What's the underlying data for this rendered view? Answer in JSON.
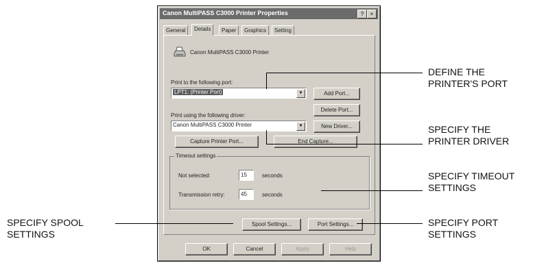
{
  "window": {
    "title": "Canon MultiPASS C3000 Printer Properties",
    "help_glyph": "?",
    "close_glyph": "×"
  },
  "tabs": [
    "General",
    "Details",
    "Paper",
    "Graphics",
    "Setting"
  ],
  "details": {
    "printer_name": "Canon MultiPASS C3000 Printer",
    "port_label": "Print to the following port:",
    "port_value": "LPT1: (Printer Port)",
    "add_port": "Add Port...",
    "delete_port": "Delete Port...",
    "driver_label": "Print using the following driver:",
    "driver_value": "Canon MultiPASS C3000 Printer",
    "new_driver": "New Driver...",
    "capture": "Capture Printer Port...",
    "end_capture": "End Capture...",
    "timeout_title": "Timeout settings",
    "not_selected_label": "Not selected:",
    "not_selected_value": "15",
    "retry_label": "Transmission retry:",
    "retry_value": "45",
    "seconds": "seconds",
    "spool": "Spool Settings...",
    "port_settings": "Port Settings..."
  },
  "footer": {
    "ok": "OK",
    "cancel": "Cancel",
    "apply": "Apply",
    "help": "Help"
  },
  "annotations": {
    "port": "DEFINE THE\nPRINTER'S PORT",
    "driver": "SPECIFY THE\nPRINTER DRIVER",
    "timeout": "SPECIFY TIMEOUT\nSETTINGS",
    "port_settings": "SPECIFY PORT\nSETTINGS",
    "spool": "SPECIFY SPOOL\nSETTINGS"
  },
  "icons": {
    "printer": "printer-icon",
    "dropdown": "chevron-down-icon"
  }
}
